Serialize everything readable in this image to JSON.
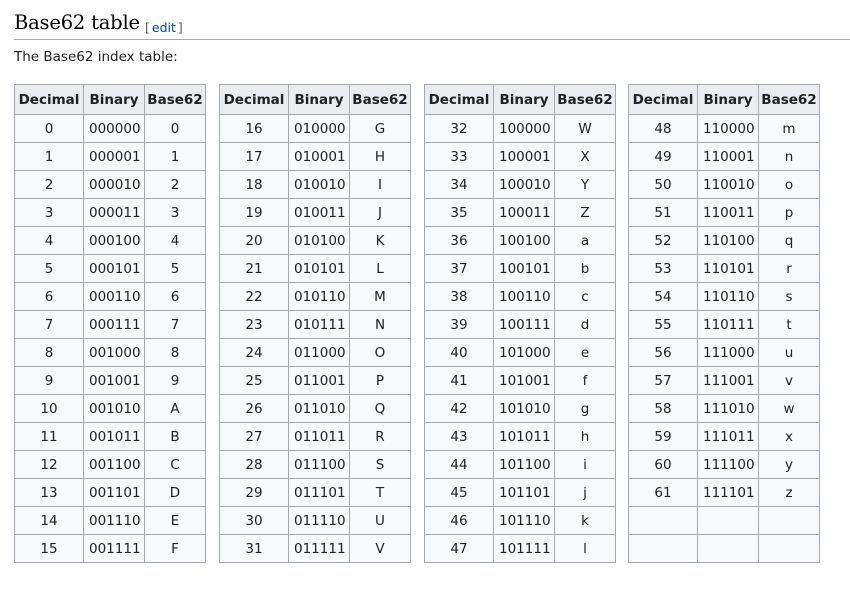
{
  "section": {
    "title": "Base62 table",
    "edit_open": "[",
    "edit_label": "edit",
    "edit_close": "]"
  },
  "intro": "The Base62 index table:",
  "headers": {
    "decimal": "Decimal",
    "binary": "Binary",
    "base62": "Base62"
  },
  "tables": [
    {
      "rows": [
        {
          "dec": "0",
          "bin": "000000",
          "b62": "0"
        },
        {
          "dec": "1",
          "bin": "000001",
          "b62": "1"
        },
        {
          "dec": "2",
          "bin": "000010",
          "b62": "2"
        },
        {
          "dec": "3",
          "bin": "000011",
          "b62": "3"
        },
        {
          "dec": "4",
          "bin": "000100",
          "b62": "4"
        },
        {
          "dec": "5",
          "bin": "000101",
          "b62": "5"
        },
        {
          "dec": "6",
          "bin": "000110",
          "b62": "6"
        },
        {
          "dec": "7",
          "bin": "000111",
          "b62": "7"
        },
        {
          "dec": "8",
          "bin": "001000",
          "b62": "8"
        },
        {
          "dec": "9",
          "bin": "001001",
          "b62": "9"
        },
        {
          "dec": "10",
          "bin": "001010",
          "b62": "A"
        },
        {
          "dec": "11",
          "bin": "001011",
          "b62": "B"
        },
        {
          "dec": "12",
          "bin": "001100",
          "b62": "C"
        },
        {
          "dec": "13",
          "bin": "001101",
          "b62": "D"
        },
        {
          "dec": "14",
          "bin": "001110",
          "b62": "E"
        },
        {
          "dec": "15",
          "bin": "001111",
          "b62": "F"
        }
      ]
    },
    {
      "rows": [
        {
          "dec": "16",
          "bin": "010000",
          "b62": "G"
        },
        {
          "dec": "17",
          "bin": "010001",
          "b62": "H"
        },
        {
          "dec": "18",
          "bin": "010010",
          "b62": "I"
        },
        {
          "dec": "19",
          "bin": "010011",
          "b62": "J"
        },
        {
          "dec": "20",
          "bin": "010100",
          "b62": "K"
        },
        {
          "dec": "21",
          "bin": "010101",
          "b62": "L"
        },
        {
          "dec": "22",
          "bin": "010110",
          "b62": "M"
        },
        {
          "dec": "23",
          "bin": "010111",
          "b62": "N"
        },
        {
          "dec": "24",
          "bin": "011000",
          "b62": "O"
        },
        {
          "dec": "25",
          "bin": "011001",
          "b62": "P"
        },
        {
          "dec": "26",
          "bin": "011010",
          "b62": "Q"
        },
        {
          "dec": "27",
          "bin": "011011",
          "b62": "R"
        },
        {
          "dec": "28",
          "bin": "011100",
          "b62": "S"
        },
        {
          "dec": "29",
          "bin": "011101",
          "b62": "T"
        },
        {
          "dec": "30",
          "bin": "011110",
          "b62": "U"
        },
        {
          "dec": "31",
          "bin": "011111",
          "b62": "V"
        }
      ]
    },
    {
      "rows": [
        {
          "dec": "32",
          "bin": "100000",
          "b62": "W"
        },
        {
          "dec": "33",
          "bin": "100001",
          "b62": "X"
        },
        {
          "dec": "34",
          "bin": "100010",
          "b62": "Y"
        },
        {
          "dec": "35",
          "bin": "100011",
          "b62": "Z"
        },
        {
          "dec": "36",
          "bin": "100100",
          "b62": "a"
        },
        {
          "dec": "37",
          "bin": "100101",
          "b62": "b"
        },
        {
          "dec": "38",
          "bin": "100110",
          "b62": "c"
        },
        {
          "dec": "39",
          "bin": "100111",
          "b62": "d"
        },
        {
          "dec": "40",
          "bin": "101000",
          "b62": "e"
        },
        {
          "dec": "41",
          "bin": "101001",
          "b62": "f"
        },
        {
          "dec": "42",
          "bin": "101010",
          "b62": "g"
        },
        {
          "dec": "43",
          "bin": "101011",
          "b62": "h"
        },
        {
          "dec": "44",
          "bin": "101100",
          "b62": "i"
        },
        {
          "dec": "45",
          "bin": "101101",
          "b62": "j"
        },
        {
          "dec": "46",
          "bin": "101110",
          "b62": "k"
        },
        {
          "dec": "47",
          "bin": "101111",
          "b62": "l"
        }
      ]
    },
    {
      "rows": [
        {
          "dec": "48",
          "bin": "110000",
          "b62": "m"
        },
        {
          "dec": "49",
          "bin": "110001",
          "b62": "n"
        },
        {
          "dec": "50",
          "bin": "110010",
          "b62": "o"
        },
        {
          "dec": "51",
          "bin": "110011",
          "b62": "p"
        },
        {
          "dec": "52",
          "bin": "110100",
          "b62": "q"
        },
        {
          "dec": "53",
          "bin": "110101",
          "b62": "r"
        },
        {
          "dec": "54",
          "bin": "110110",
          "b62": "s"
        },
        {
          "dec": "55",
          "bin": "110111",
          "b62": "t"
        },
        {
          "dec": "56",
          "bin": "111000",
          "b62": "u"
        },
        {
          "dec": "57",
          "bin": "111001",
          "b62": "v"
        },
        {
          "dec": "58",
          "bin": "111010",
          "b62": "w"
        },
        {
          "dec": "59",
          "bin": "111011",
          "b62": "x"
        },
        {
          "dec": "60",
          "bin": "111100",
          "b62": "y"
        },
        {
          "dec": "61",
          "bin": "111101",
          "b62": "z"
        },
        {
          "dec": "",
          "bin": "",
          "b62": ""
        },
        {
          "dec": "",
          "bin": "",
          "b62": ""
        }
      ]
    }
  ]
}
